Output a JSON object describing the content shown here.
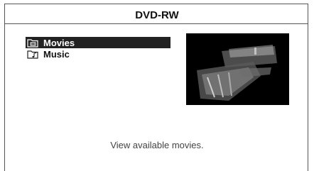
{
  "header": {
    "title": "DVD-RW"
  },
  "menu": {
    "items": [
      {
        "label": "Movies",
        "icon": "folder-film-icon",
        "selected": true
      },
      {
        "label": "Music",
        "icon": "folder-music-icon",
        "selected": false
      }
    ]
  },
  "preview": {
    "icon": "movie-preview-thumbnail"
  },
  "footer": {
    "description": "View available movies."
  },
  "colors": {
    "selection_bg": "#222222",
    "text": "#111111",
    "border": "#555555"
  }
}
